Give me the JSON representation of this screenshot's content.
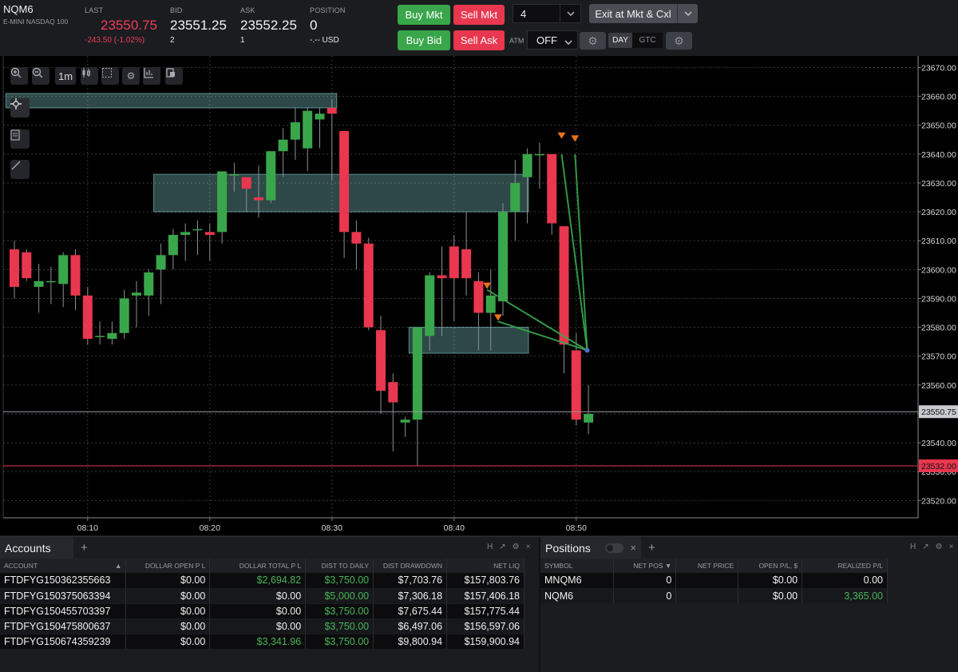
{
  "header": {
    "symbol": "NQM6",
    "description": "E-MINI NASDAQ 100",
    "last_label": "LAST",
    "last_value": "23550.75",
    "last_change": "-243.50 (-1.02%)",
    "bid_label": "BID",
    "bid_value": "23551.25",
    "bid_size": "2",
    "ask_label": "ASK",
    "ask_value": "23552.25",
    "ask_size": "1",
    "position_label": "POSITION",
    "position_value": "0",
    "position_pnl": "-.-- USD"
  },
  "order_entry": {
    "buy_mkt": "Buy Mkt",
    "sell_mkt": "Sell Mkt",
    "buy_bid": "Buy Bid",
    "sell_ask": "Sell Ask",
    "quantity": "4",
    "exit_label": "Exit at Mkt & Cxl",
    "atm_label": "ATM",
    "atm_value": "OFF",
    "tif_day": "DAY",
    "tif_gtc": "GTC"
  },
  "chart_toolbar": {
    "interval": "1m"
  },
  "chart_data": {
    "type": "candlestick",
    "ylim": [
      23514,
      23674
    ],
    "y_ticks": [
      "23670.00",
      "23660.00",
      "23650.00",
      "23640.00",
      "23630.00",
      "23620.00",
      "23610.00",
      "23600.00",
      "23590.00",
      "23580.00",
      "23570.00",
      "23560.00",
      "23550.00",
      "23540.00",
      "23530.00",
      "23520.00"
    ],
    "x_ticks": [
      {
        "label": "08:10",
        "index": 6
      },
      {
        "label": "08:20",
        "index": 16
      },
      {
        "label": "08:30",
        "index": 26
      },
      {
        "label": "08:40",
        "index": 36
      },
      {
        "label": "08:50",
        "index": 46
      }
    ],
    "last_price_label": "23550.75",
    "last_price": 23550.75,
    "red_line_label": "23532.00",
    "red_line_price": 23532,
    "candles": [
      [
        23607,
        23610,
        23590,
        23594
      ],
      [
        23606,
        23607,
        23596,
        23597
      ],
      [
        23594,
        23602,
        23585,
        23596
      ],
      [
        23596,
        23601,
        23588,
        23596
      ],
      [
        23595,
        23606,
        23587,
        23605
      ],
      [
        23605,
        23607,
        23586,
        23591
      ],
      [
        23591,
        23594,
        23574,
        23576
      ],
      [
        23577,
        23582,
        23574,
        23577
      ],
      [
        23576,
        23582,
        23574,
        23578
      ],
      [
        23578,
        23593,
        23576,
        23590
      ],
      [
        23591,
        23596,
        23580,
        23592
      ],
      [
        23591,
        23600,
        23584,
        23599
      ],
      [
        23600,
        23609,
        23588,
        23605
      ],
      [
        23605,
        23614,
        23600,
        23612
      ],
      [
        23612,
        23616,
        23603,
        23613
      ],
      [
        23614,
        23617,
        23605,
        23614
      ],
      [
        23613,
        23616,
        23603,
        23612
      ],
      [
        23613,
        23633,
        23609,
        23634
      ],
      [
        23633,
        23637,
        23627,
        23633
      ],
      [
        23632,
        23631,
        23620,
        23628
      ],
      [
        23625,
        23636,
        23618,
        23624
      ],
      [
        23624,
        23639,
        23623,
        23641
      ],
      [
        23641,
        23649,
        23632,
        23645
      ],
      [
        23645,
        23656,
        23638,
        23651
      ],
      [
        23642,
        23656,
        23634,
        23655
      ],
      [
        23652,
        23656,
        23642,
        23654
      ],
      [
        23656,
        23659,
        23631,
        23654
      ],
      [
        23648,
        23648,
        23604,
        23613
      ],
      [
        23613,
        23617,
        23600,
        23609
      ],
      [
        23609,
        23611,
        23579,
        23580
      ],
      [
        23579,
        23584,
        23550,
        23558
      ],
      [
        23561,
        23564,
        23537,
        23554
      ],
      [
        23547,
        23549,
        23542,
        23548
      ],
      [
        23548,
        23565,
        23532,
        23580
      ],
      [
        23577,
        23599,
        23572,
        23598
      ],
      [
        23598,
        23608,
        23577,
        23597
      ],
      [
        23608,
        23612,
        23582,
        23597
      ],
      [
        23607,
        23620,
        23591,
        23597
      ],
      [
        23596,
        23599,
        23572,
        23585
      ],
      [
        23585,
        23600,
        23572,
        23591
      ],
      [
        23589,
        23623,
        23584,
        23620
      ],
      [
        23620,
        23638,
        23610,
        23630
      ],
      [
        23632,
        23642,
        23616,
        23640
      ],
      [
        23640,
        23644,
        23628,
        23640
      ],
      [
        23640,
        23637,
        23612,
        23616
      ],
      [
        23615,
        23613,
        23564,
        23574
      ],
      [
        23572,
        23578,
        23546,
        23548
      ],
      [
        23547,
        23560,
        23543,
        23550
      ]
    ],
    "zones": [
      {
        "i0": -0.3,
        "i1": 26.0,
        "p0": 23656,
        "p1": 23661
      },
      {
        "i0": 11.8,
        "i1": 41.7,
        "p0": 23620,
        "p1": 23633
      },
      {
        "i0": 32.7,
        "i1": 41.7,
        "p0": 23571,
        "p1": 23580
      }
    ],
    "markers": [
      {
        "i": 38.7,
        "p": 23593
      },
      {
        "i": 39.6,
        "p": 23582
      },
      {
        "i": 44.8,
        "p": 23645
      },
      {
        "i": 45.9,
        "p": 23644
      }
    ],
    "lines": [
      {
        "i0": 38.7,
        "p0": 23593,
        "i1": 46.9,
        "p1": 23572
      },
      {
        "i0": 39.6,
        "p0": 23582,
        "i1": 46.9,
        "p1": 23572
      },
      {
        "i0": 44.8,
        "p0": 23640,
        "i1": 46.9,
        "p1": 23572
      },
      {
        "i0": 45.9,
        "p0": 23640,
        "i1": 46.9,
        "p1": 23572
      }
    ],
    "colors": {
      "up": "#3aa64b",
      "down": "#e8374f",
      "zone": "#8fe0e0",
      "trend": "#3aa64b",
      "marker": "#e8721c",
      "grid": "#3a3b40"
    }
  },
  "accounts": {
    "tab_label": "Accounts",
    "columns": [
      "ACCOUNT",
      "DOLLAR OPEN P L",
      "DOLLAR TOTAL P L",
      "DIST TO DAILY",
      "DIST DRAWDOWN",
      "NET LIQ"
    ],
    "rows": [
      [
        "FTDFYG150362355663",
        "$0.00",
        "$2,694.82",
        "$3,750.00",
        "$7,703.76",
        "$157,803.76"
      ],
      [
        "FTDFYG150375063394",
        "$0.00",
        "$0.00",
        "$5,000.00",
        "$7,306.18",
        "$157,406.18"
      ],
      [
        "FTDFYG150455703397",
        "$0.00",
        "$0.00",
        "$3,750.00",
        "$7,675.44",
        "$157,775.44"
      ],
      [
        "FTDFYG150475800637",
        "$0.00",
        "$0.00",
        "$3,750.00",
        "$6,497.06",
        "$156,597.06"
      ],
      [
        "FTDFYG150674359239",
        "$0.00",
        "$3,341.96",
        "$3,750.00",
        "$9,800.94",
        "$159,900.94"
      ]
    ]
  },
  "positions": {
    "tab_label": "Positions",
    "columns": [
      "SYMBOL",
      "NET POS ▼",
      "NET PRICE",
      "OPEN P/L, $",
      "REALIZED P/L"
    ],
    "rows": [
      [
        "MNQM6",
        "0",
        "",
        "$0.00",
        "0.00"
      ],
      [
        "NQM6",
        "0",
        "",
        "$0.00",
        "3,365.00"
      ]
    ]
  },
  "panel_icons": [
    "H",
    "↗",
    "⚙",
    "×"
  ]
}
